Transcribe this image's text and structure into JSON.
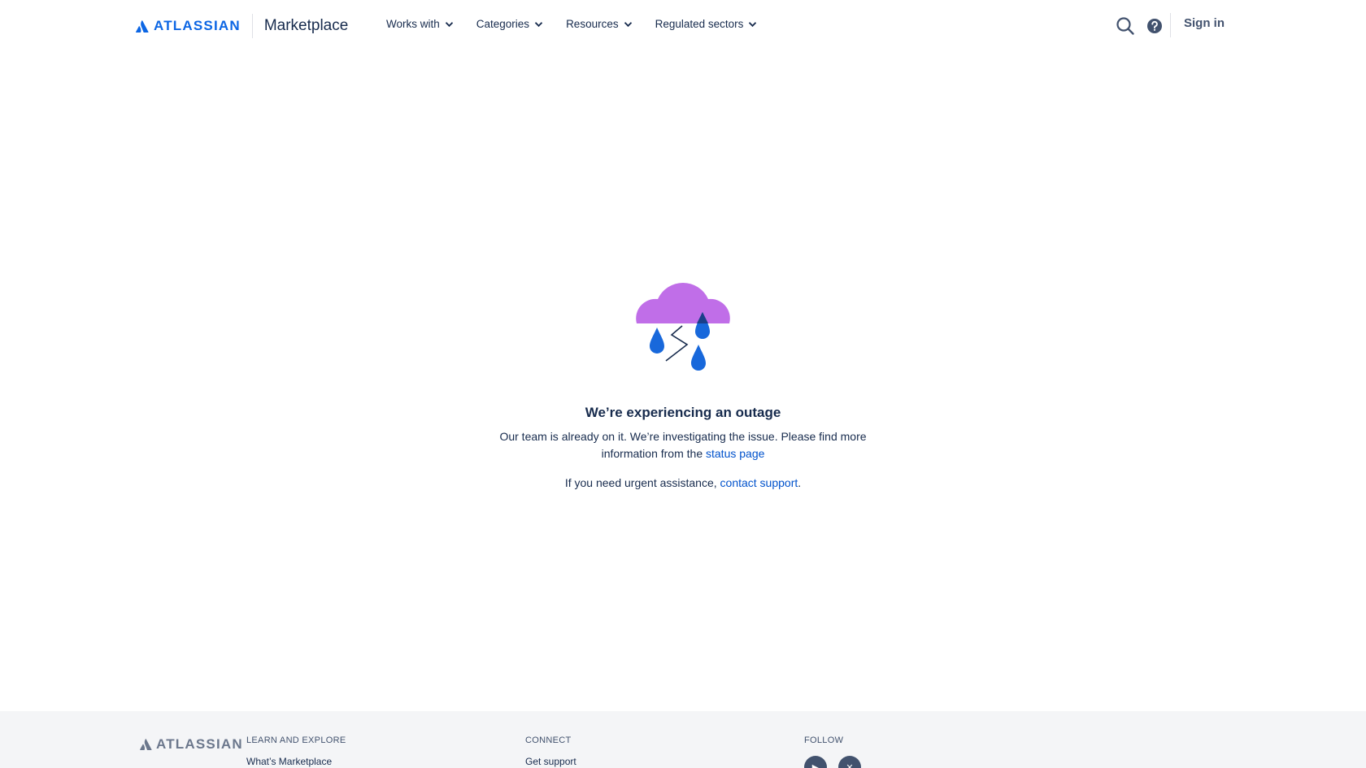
{
  "header": {
    "brand_word": "ATLASSIAN",
    "product": "Marketplace",
    "nav": [
      {
        "label": "Works with"
      },
      {
        "label": "Categories"
      },
      {
        "label": "Resources"
      },
      {
        "label": "Regulated sectors"
      }
    ],
    "signin": "Sign in",
    "icons": {
      "search": "search-icon",
      "help": "help-icon"
    }
  },
  "outage": {
    "title": "We’re experiencing an outage",
    "body_text": "Our team is already on it. We’re investigating the issue. Please find more information from the",
    "status_link": "status page",
    "urgent_text": "If you need urgent assistance,",
    "support_link": "contact support",
    "urgent_end": "."
  },
  "footer": {
    "brand_word": "ATLASSIAN",
    "columns": [
      {
        "heading": "LEARN AND EXPLORE",
        "first_link": "What’s Marketplace"
      },
      {
        "heading": "CONNECT",
        "first_link": "Get support"
      },
      {
        "heading": "FOLLOW"
      }
    ],
    "social_icons": [
      "youtube-icon",
      "x-icon"
    ]
  },
  "colors": {
    "brand_blue": "#0c66e4",
    "link": "#0052cc",
    "cloud": "#c06ee8",
    "drop": "#1868db",
    "text": "#172b4d",
    "footer_bg": "#f4f5f7"
  }
}
